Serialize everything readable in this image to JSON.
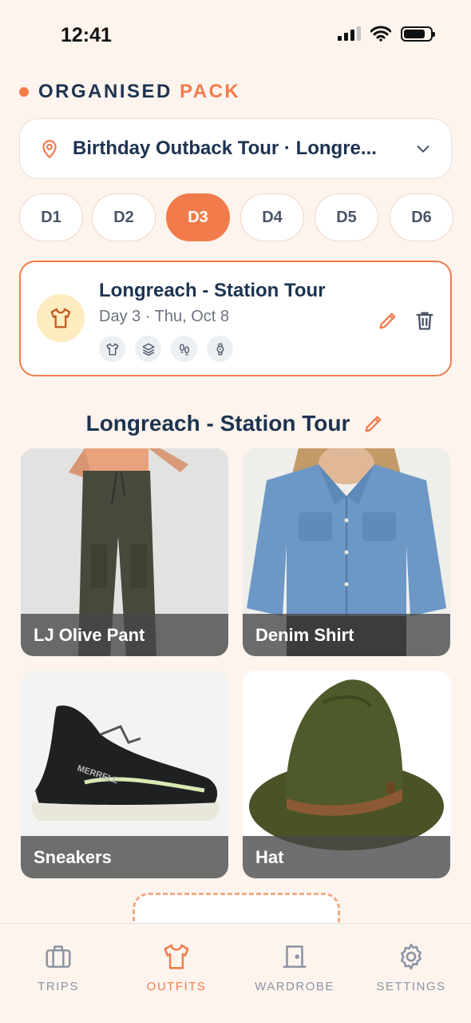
{
  "status": {
    "time": "12:41"
  },
  "brand": {
    "word1": "ORGANISED",
    "word2": "PACK"
  },
  "trip_selector": {
    "label": "Birthday Outback Tour · Longre..."
  },
  "days": [
    "D1",
    "D2",
    "D3",
    "D4",
    "D5",
    "D6"
  ],
  "active_day": "D3",
  "outfit": {
    "title": "Longreach - Station Tour",
    "subtitle": "Day 3 · Thu, Oct 8",
    "tags": [
      "shirt-icon",
      "layers-icon",
      "footprints-icon",
      "watch-icon"
    ]
  },
  "section": {
    "title": "Longreach - Station Tour"
  },
  "items": [
    {
      "label": "LJ Olive Pant",
      "icon": "olive-pants-photo"
    },
    {
      "label": "Denim Shirt",
      "icon": "denim-shirt-photo"
    },
    {
      "label": "Sneakers",
      "icon": "sneakers-photo"
    },
    {
      "label": "Hat",
      "icon": "hat-photo"
    }
  ],
  "tabs": [
    {
      "label": "TRIPS",
      "icon": "suitcase-icon",
      "active": false
    },
    {
      "label": "OUTFITS",
      "icon": "shirt-icon",
      "active": true
    },
    {
      "label": "WARDROBE",
      "icon": "wardrobe-icon",
      "active": false
    },
    {
      "label": "SETTINGS",
      "icon": "gear-icon",
      "active": false
    }
  ],
  "colors": {
    "accent": "#f27b4b",
    "navy": "#1d3350",
    "background": "#fdf4ee"
  }
}
